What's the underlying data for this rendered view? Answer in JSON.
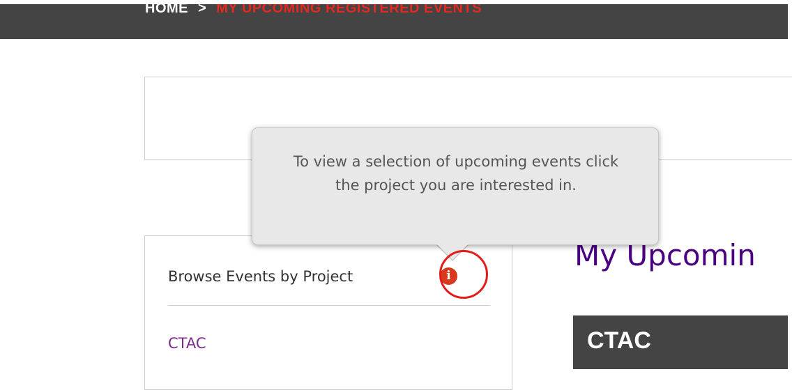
{
  "breadcrumb": {
    "home": "HOME",
    "separator": ">",
    "current": "MY UPCOMING REGISTERED EVENTS"
  },
  "sidebar": {
    "title": "Browse Events by Project",
    "info_icon": "info-icon",
    "projects": [
      "CTAC"
    ]
  },
  "tooltip": {
    "text": "To view a selection of upcoming events click the project you are interested in."
  },
  "main": {
    "heading": "My Upcomin",
    "project_bar_title": "CTAC"
  },
  "colors": {
    "header_bg": "#444444",
    "breadcrumb_active": "#e02a1f",
    "link": "#7b2a8c",
    "heading": "#4b0082",
    "info_icon": "#d93a1d",
    "annotation": "#e41b1b"
  }
}
